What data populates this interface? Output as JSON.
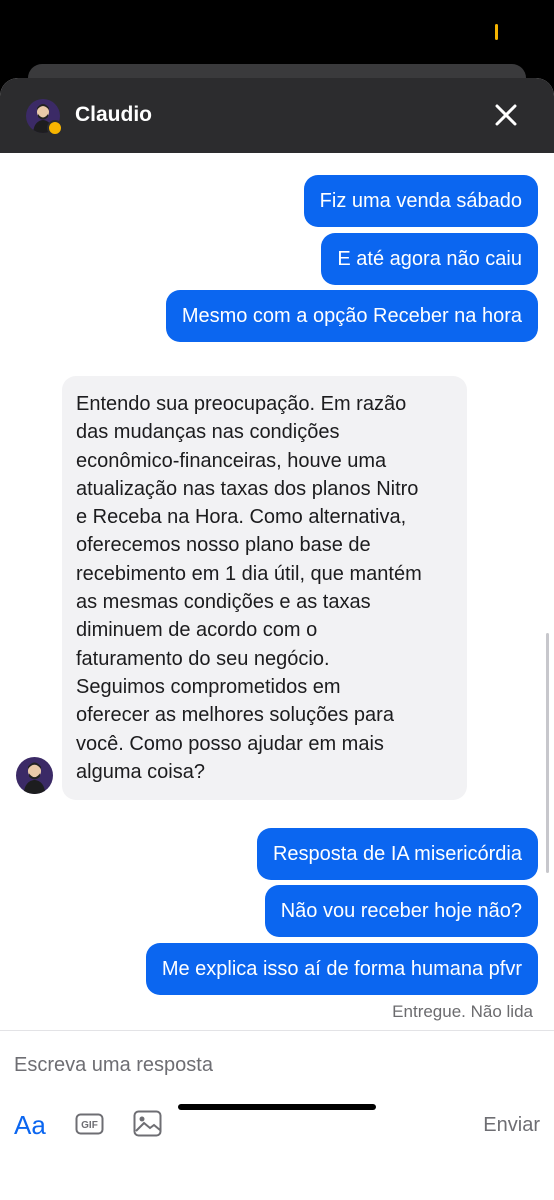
{
  "header": {
    "name": "Claudio"
  },
  "messages_out_top": [
    "Fiz uma venda sábado",
    "E até agora não caiu",
    "Mesmo com a opção Receber na hora"
  ],
  "message_in": {
    "lines": [
      "Entendo sua preocupação. Em razão",
      "das mudanças nas condições",
      "econômico-financeiras, houve uma",
      "atualização nas taxas dos planos Nitro",
      "e Receba na Hora. Como alternativa,",
      "oferecemos nosso plano base de",
      "recebimento em 1 dia útil, que mantém",
      "as mesmas condições e as taxas",
      "diminuem de acordo com o",
      "faturamento do seu negócio.",
      "Seguimos comprometidos em",
      "oferecer as melhores soluções para",
      "você. Como posso ajudar em mais",
      "alguma coisa?"
    ]
  },
  "messages_out_bottom": [
    "Resposta de IA misericórdia",
    "Não vou receber hoje não?",
    "Me explica isso aí de forma humana pfvr"
  ],
  "status": {
    "delivered": "Entregue. Não lida"
  },
  "composer": {
    "placeholder": "Escreva uma resposta",
    "aa_label": "Aa",
    "gif_label": "GIF",
    "send_label": "Enviar"
  },
  "colors": {
    "accent": "#0b66f0",
    "header_bg": "#2c2c2e",
    "incoming_bg": "#f2f2f4",
    "online": "#f7b500"
  },
  "icons": [
    "close-icon",
    "gif-icon",
    "image-icon",
    "avatar"
  ]
}
